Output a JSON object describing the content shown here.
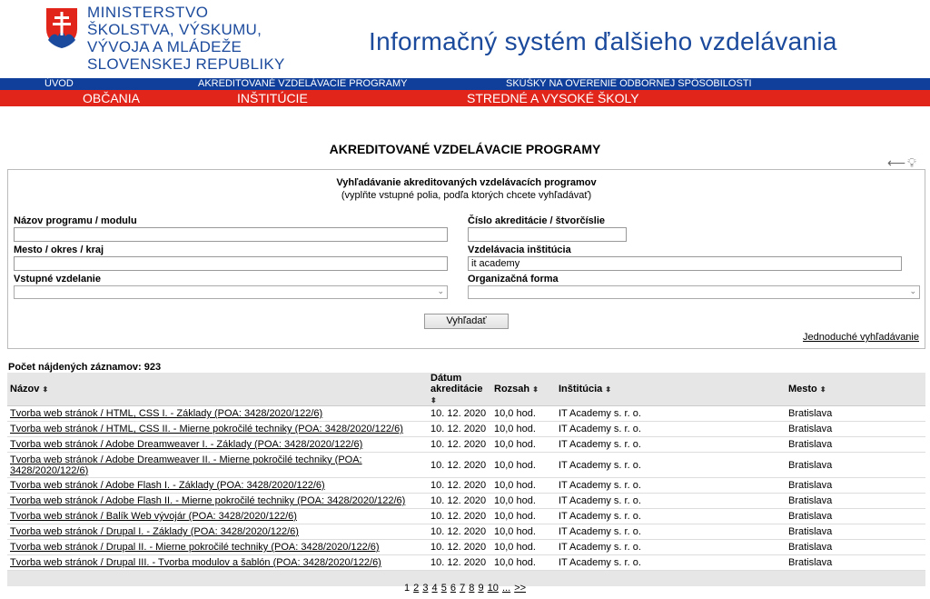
{
  "header": {
    "ministry_line1": "MINISTERSTVO",
    "ministry_line2": "ŠKOLSTVA, VÝSKUMU,",
    "ministry_line3": "VÝVOJA A MLÁDEŽE",
    "ministry_line4": "SLOVENSKEJ REPUBLIKY",
    "site_title": "Informačný systém ďalšieho vzdelávania",
    "brand_blue": "#1b4a9c",
    "brand_red": "#e1251b"
  },
  "nav_top": [
    "ÚVOD",
    "AKREDITOVANÉ VZDELÁVACIE PROGRAMY",
    "SKÚŠKY NA OVERENIE ODBORNEJ SPÔSOBILOSTI"
  ],
  "nav_bottom": [
    "OBČANIA",
    "INŠTITÚCIE",
    "STREDNÉ A VYSOKÉ ŠKOLY"
  ],
  "page_heading": "AKREDITOVANÉ VZDELÁVACIE PROGRAMY",
  "icons": [
    "back-arrow-icon",
    "lightbulb-icon"
  ],
  "search": {
    "title": "Vyhľadávanie akreditovaných vzdelávacích programov",
    "subtitle": "(vyplňte vstupné polia, podľa ktorých chcete vyhľadávať)",
    "fields": {
      "program_name": {
        "label": "Názov programu / modulu",
        "value": ""
      },
      "accreditation_number": {
        "label": "Číslo akreditácie / štvorčíslie",
        "value": ""
      },
      "location": {
        "label": "Mesto / okres / kraj",
        "value": ""
      },
      "institution": {
        "label": "Vzdelávacia inštitúcia",
        "value": "it academy"
      },
      "entry_education": {
        "label": "Vstupné vzdelanie",
        "value": ""
      },
      "organization_form": {
        "label": "Organizačná forma",
        "value": ""
      }
    },
    "submit_label": "Vyhľadať",
    "simple_search_link": "Jednoduché vyhľadávanie"
  },
  "results": {
    "count_text": "Počet nájdených záznamov: 923",
    "columns": {
      "name": "Názov",
      "date_line1": "Dátum",
      "date_line2": "akreditácie",
      "range": "Rozsah",
      "institution": "Inštitúcia",
      "city": "Mesto",
      "sort_glyph": "⬍"
    },
    "rows": [
      {
        "name": "Tvorba web stránok / HTML, CSS I. - Základy (POA: 3428/2020/122/6)",
        "date": "10. 12. 2020",
        "range": "10,0 hod.",
        "institution": "IT Academy s. r. o.",
        "city": "Bratislava"
      },
      {
        "name": "Tvorba web stránok / HTML, CSS II. - Mierne pokročilé techniky (POA: 3428/2020/122/6)",
        "date": "10. 12. 2020",
        "range": "10,0 hod.",
        "institution": "IT Academy s. r. o.",
        "city": "Bratislava"
      },
      {
        "name": "Tvorba web stránok / Adobe Dreamweaver I. - Základy (POA: 3428/2020/122/6)",
        "date": "10. 12. 2020",
        "range": "10,0 hod.",
        "institution": "IT Academy s. r. o.",
        "city": "Bratislava"
      },
      {
        "name": "Tvorba web stránok / Adobe Dreamweaver II. - Mierne pokročilé techniky (POA: 3428/2020/122/6)",
        "date": "10. 12. 2020",
        "range": "10,0 hod.",
        "institution": "IT Academy s. r. o.",
        "city": "Bratislava"
      },
      {
        "name": "Tvorba web stránok / Adobe Flash I. - Základy (POA: 3428/2020/122/6)",
        "date": "10. 12. 2020",
        "range": "10,0 hod.",
        "institution": "IT Academy s. r. o.",
        "city": "Bratislava"
      },
      {
        "name": "Tvorba web stránok / Adobe Flash II. - Mierne pokročilé techniky (POA: 3428/2020/122/6)",
        "date": "10. 12. 2020",
        "range": "10,0 hod.",
        "institution": "IT Academy s. r. o.",
        "city": "Bratislava"
      },
      {
        "name": "Tvorba web stránok / Balík Web vývojár (POA: 3428/2020/122/6)",
        "date": "10. 12. 2020",
        "range": "10,0 hod.",
        "institution": "IT Academy s. r. o.",
        "city": "Bratislava"
      },
      {
        "name": "Tvorba web stránok / Drupal I. - Základy (POA: 3428/2020/122/6)",
        "date": "10. 12. 2020",
        "range": "10,0 hod.",
        "institution": "IT Academy s. r. o.",
        "city": "Bratislava"
      },
      {
        "name": "Tvorba web stránok / Drupal II. - Mierne pokročilé techniky (POA: 3428/2020/122/6)",
        "date": "10. 12. 2020",
        "range": "10,0 hod.",
        "institution": "IT Academy s. r. o.",
        "city": "Bratislava"
      },
      {
        "name": "Tvorba web stránok / Drupal III. - Tvorba modulov a šablón (POA: 3428/2020/122/6)",
        "date": "10. 12. 2020",
        "range": "10,0 hod.",
        "institution": "IT Academy s. r. o.",
        "city": "Bratislava"
      }
    ]
  },
  "pagination": {
    "pages": [
      "1",
      "2",
      "3",
      "4",
      "5",
      "6",
      "7",
      "8",
      "9",
      "10"
    ],
    "ellipsis": "...",
    "next": ">>"
  }
}
